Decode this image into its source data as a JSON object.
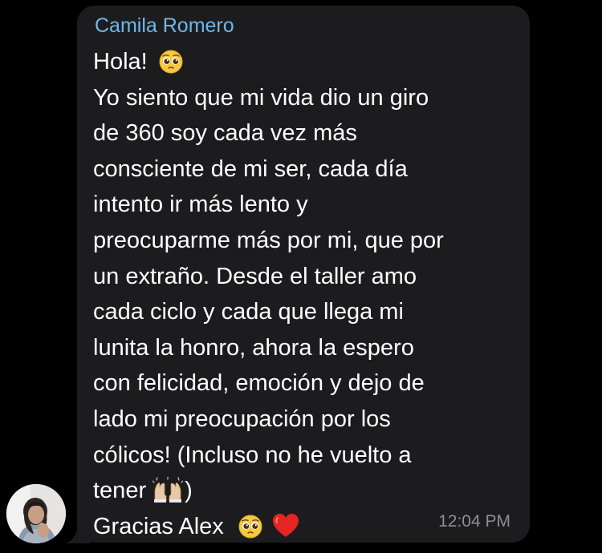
{
  "message": {
    "sender_name": "Camila Romero",
    "lines": [
      "Hola!",
      "Yo siento que mi vida dio un giro",
      "de 360 soy cada vez más",
      "consciente de mi ser, cada día",
      "intento ir más lento y",
      "preocuparme más por mi, que por",
      "un extraño. Desde el taller amo",
      "cada ciclo y cada que llega mi",
      "lunita la honro, ahora la espero",
      "con felicidad, emoción y dejo de",
      "lado mi preocupación por los",
      "cólicos! (Incluso no he vuelto a",
      "tener",
      ")",
      "Gracias Alex"
    ],
    "timestamp": "12:04 PM"
  },
  "icons": {
    "pleading_face": "pleading-face-emoji",
    "raising_hands": "raising-hands-emoji",
    "red_heart": "red-heart-emoji"
  },
  "colors": {
    "background": "#000000",
    "bubble": "#1c1c1e",
    "sender_name": "#6fb7ea",
    "message_text": "#ffffff",
    "timestamp": "#8e8e93"
  }
}
